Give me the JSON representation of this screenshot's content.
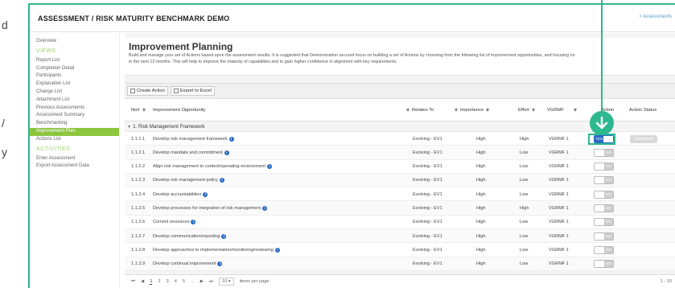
{
  "left_crop": [
    "d",
    "/",
    "y"
  ],
  "app": {
    "title": "ASSESSMENT / RISK MATURITY BENCHMARK DEMO",
    "breadcrumb": "> Assessments"
  },
  "sidebar": {
    "overview": "Overview",
    "views_head": "VIEWS",
    "views": [
      "Report List",
      "Completion Detail",
      "Participants",
      "Explanation List",
      "Change List",
      "Attachment List",
      "Previous Assessments",
      "Assessment Summary",
      "Benchmarking",
      "Improvement Plan",
      "Actions List"
    ],
    "activities_head": "ACTIVITIES",
    "activities": [
      "Enter Assessment",
      "Export Assessment Data"
    ]
  },
  "page": {
    "title": "Improvement Planning",
    "desc_line1": "Build and manage your set of Actions based upon the assessment results. It is suggested that Demonstration account focus on building a set of Actions by choosing from the following list of improvement opportunities, and focusing on",
    "desc_line2": "in the next 12 months. This will help to improve the maturity of capabilities and to gain higher confidence in alignment with key requirements."
  },
  "toolbar": {
    "create": "Create Action",
    "export": "Export to Excel"
  },
  "columns": {
    "no": "No#",
    "opportunity": "Improvement Opportunity",
    "relates": "Relates To",
    "importance": "Importance",
    "effort": "Effort",
    "vgrmf": "VGRMF",
    "action": "Action",
    "status": "Action Status"
  },
  "group": "1. Risk Management Framework",
  "rows": [
    {
      "no": "1.1.1.1",
      "opp": "Develop risk management framework",
      "rel": "Evolving - EV1",
      "imp": "High",
      "eff": "High",
      "vg": "VGRMF 1",
      "toggle": "YES",
      "status": "Unplanned"
    },
    {
      "no": "1.1.2.1",
      "opp": "Develop mandate and commitment",
      "rel": "Evolving - EV1",
      "imp": "High",
      "eff": "Low",
      "vg": "VGRMF 1",
      "toggle": "NO",
      "status": ""
    },
    {
      "no": "1.1.2.2",
      "opp": "Align risk management to context/operating environment",
      "rel": "Evolving - EV1",
      "imp": "High",
      "eff": "Low",
      "vg": "VGRMF 1",
      "toggle": "NO",
      "status": ""
    },
    {
      "no": "1.1.2.3",
      "opp": "Develop risk management policy",
      "rel": "Evolving - EV1",
      "imp": "High",
      "eff": "Low",
      "vg": "VGRMF 1",
      "toggle": "NO",
      "status": ""
    },
    {
      "no": "1.1.2.4",
      "opp": "Develop accountabilities",
      "rel": "Evolving - EV1",
      "imp": "High",
      "eff": "Low",
      "vg": "VGRMF 1",
      "toggle": "NO",
      "status": ""
    },
    {
      "no": "1.1.2.5",
      "opp": "Develop processes for integration of risk management",
      "rel": "Evolving - EV1",
      "imp": "High",
      "eff": "High",
      "vg": "VGRMF 1",
      "toggle": "NO",
      "status": ""
    },
    {
      "no": "1.1.2.6",
      "opp": "Commit resources",
      "rel": "Evolving - EV1",
      "imp": "High",
      "eff": "Low",
      "vg": "VGRMF 1",
      "toggle": "NO",
      "status": ""
    },
    {
      "no": "1.1.2.7",
      "opp": "Develop communication/reporting",
      "rel": "Evolving - EV1",
      "imp": "High",
      "eff": "Low",
      "vg": "VGRMF 1",
      "toggle": "NO",
      "status": ""
    },
    {
      "no": "1.1.2.8",
      "opp": "Develop approaches to implementation/monitoring/reviewing",
      "rel": "Evolving - EV1",
      "imp": "High",
      "eff": "Low",
      "vg": "VGRMF 1",
      "toggle": "NO",
      "status": ""
    },
    {
      "no": "1.1.2.9",
      "opp": "Develop continual improvement",
      "rel": "Evolving - EV1",
      "imp": "High",
      "eff": "Low",
      "vg": "VGRMF 1",
      "toggle": "NO",
      "status": ""
    }
  ],
  "pager": {
    "first": "⏮",
    "prev": "◀",
    "pages": [
      "1",
      "2",
      "3",
      "4",
      "5",
      "..."
    ],
    "next": "▶",
    "last": "⏭",
    "size": "10",
    "items_label": "items per page",
    "right_info": "1 - 10"
  },
  "colors": {
    "accent": "#2db88f",
    "active": "#8cc63f",
    "blue": "#2a6bc1"
  }
}
